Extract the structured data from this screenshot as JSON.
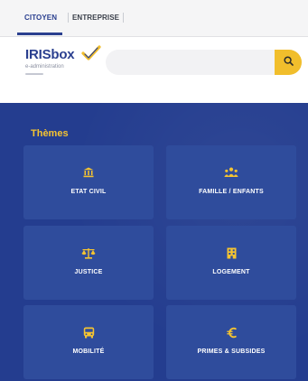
{
  "top_tabs": {
    "citoyen": "CITOYEN",
    "entreprise": "ENTREPRISE"
  },
  "logo": {
    "name": "IRISbox",
    "subtitle": "e-administration"
  },
  "search": {
    "placeholder": "",
    "icon": "search-icon"
  },
  "themes": {
    "title": "Thèmes",
    "items": [
      {
        "label": "ETAT CIVIL",
        "icon": "bank-icon"
      },
      {
        "label": "FAMILLE / ENFANTS",
        "icon": "family-icon"
      },
      {
        "label": "JUSTICE",
        "icon": "scales-icon"
      },
      {
        "label": "LOGEMENT",
        "icon": "building-icon"
      },
      {
        "label": "MOBILITÉ",
        "icon": "bus-icon"
      },
      {
        "label": "PRIMES & SUBSIDES",
        "icon": "euro-icon"
      }
    ]
  },
  "colors": {
    "brand_blue": "#243d8f",
    "card_blue": "#2f4c9c",
    "accent_yellow": "#f5c431",
    "search_button": "#f1be2c"
  }
}
